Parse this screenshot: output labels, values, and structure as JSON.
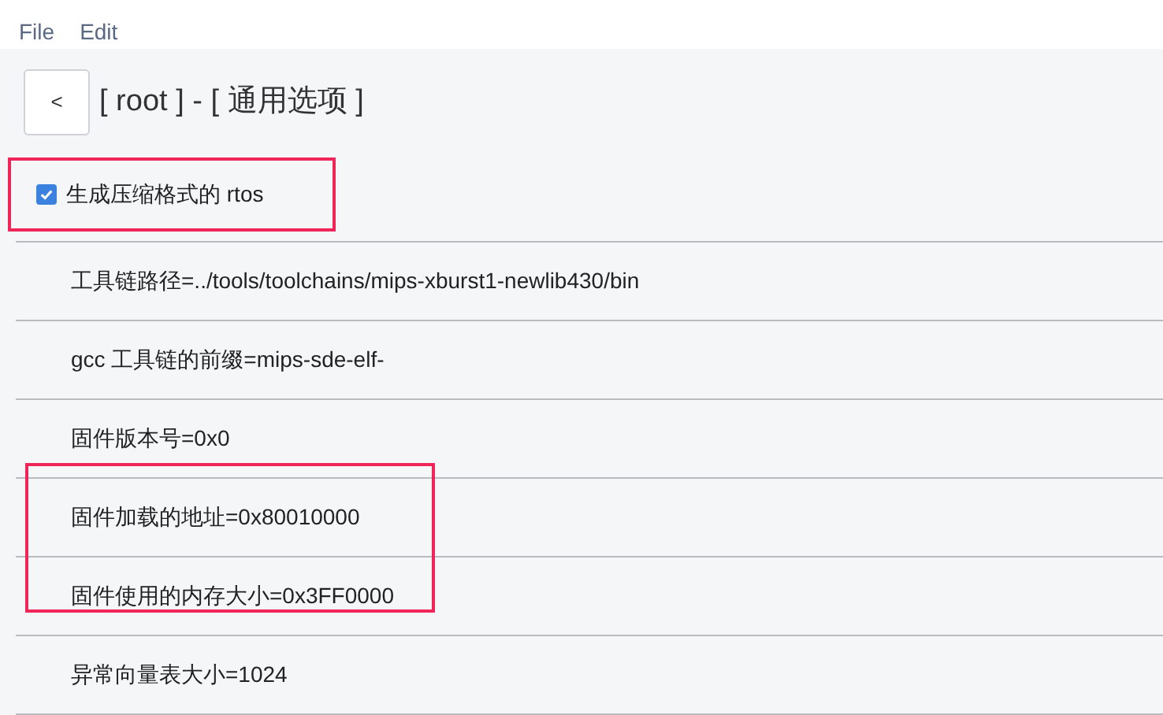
{
  "menu": [
    "File",
    "Edit"
  ],
  "header": {
    "back": "<",
    "title": "[ root ] - [ 通用选项 ]"
  },
  "checkbox": {
    "label": "生成压缩格式的 rtos",
    "checked": true,
    "highlighted": true
  },
  "options": [
    {
      "label": "工具链路径=../tools/toolchains/mips-xburst1-newlib430/bin",
      "highlighted": false
    },
    {
      "label": "gcc 工具链的前缀=mips-sde-elf-",
      "highlighted": false
    },
    {
      "label": "固件版本号=0x0",
      "highlighted": false
    },
    {
      "label": "固件加载的地址=0x80010000",
      "highlighted": true
    },
    {
      "label": "固件使用的内存大小=0x3FF0000",
      "highlighted": true
    },
    {
      "label": "异常向量表大小=1024",
      "highlighted": false
    }
  ]
}
